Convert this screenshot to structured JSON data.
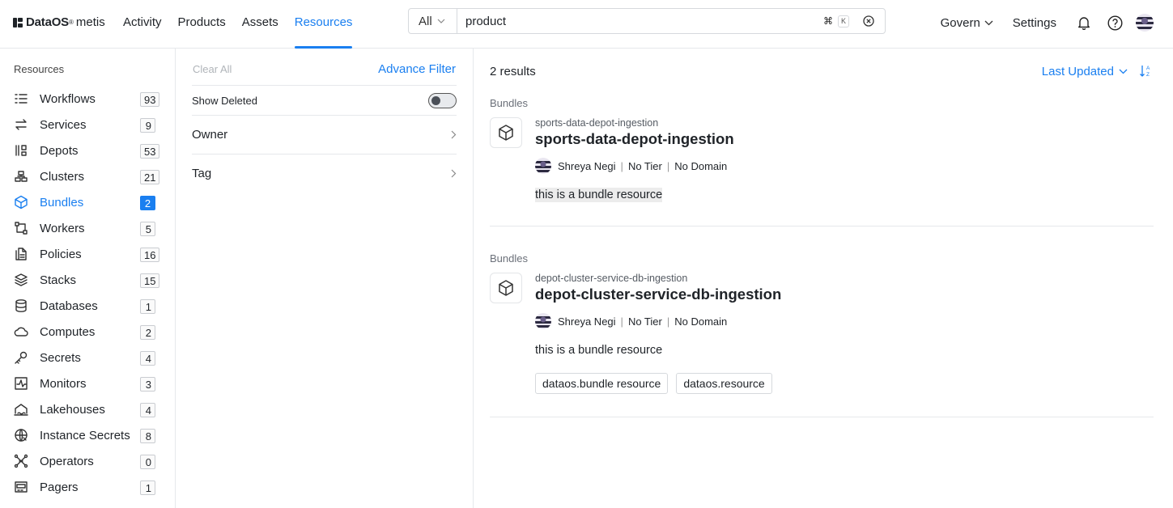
{
  "header": {
    "logo": {
      "brand": "DataOS",
      "sup": "®",
      "product": "metis"
    },
    "nav": [
      {
        "label": "Activity",
        "active": false
      },
      {
        "label": "Products",
        "active": false
      },
      {
        "label": "Assets",
        "active": false
      },
      {
        "label": "Resources",
        "active": true
      }
    ],
    "search": {
      "scope": "All",
      "value": "product",
      "shortcut_cmd": "⌘",
      "shortcut_key": "K"
    },
    "govern_label": "Govern",
    "settings_label": "Settings",
    "icons": [
      "bell-icon",
      "help-icon",
      "avatar"
    ]
  },
  "sidebar": {
    "title": "Resources",
    "items": [
      {
        "label": "Workflows",
        "count": "93",
        "icon": "workflow-icon"
      },
      {
        "label": "Services",
        "count": "9",
        "icon": "services-icon"
      },
      {
        "label": "Depots",
        "count": "53",
        "icon": "depot-icon"
      },
      {
        "label": "Clusters",
        "count": "21",
        "icon": "cluster-icon"
      },
      {
        "label": "Bundles",
        "count": "2",
        "icon": "bundle-icon",
        "active": true
      },
      {
        "label": "Workers",
        "count": "5",
        "icon": "worker-icon"
      },
      {
        "label": "Policies",
        "count": "16",
        "icon": "policy-icon"
      },
      {
        "label": "Stacks",
        "count": "15",
        "icon": "stack-icon"
      },
      {
        "label": "Databases",
        "count": "1",
        "icon": "database-icon"
      },
      {
        "label": "Computes",
        "count": "2",
        "icon": "cloud-icon"
      },
      {
        "label": "Secrets",
        "count": "4",
        "icon": "key-icon"
      },
      {
        "label": "Monitors",
        "count": "3",
        "icon": "monitor-icon"
      },
      {
        "label": "Lakehouses",
        "count": "4",
        "icon": "lakehouse-icon"
      },
      {
        "label": "Instance Secrets",
        "count": "8",
        "icon": "instance-secret-icon"
      },
      {
        "label": "Operators",
        "count": "0",
        "icon": "operator-icon"
      },
      {
        "label": "Pagers",
        "count": "1",
        "icon": "pager-icon"
      }
    ]
  },
  "filters": {
    "clear_all": "Clear All",
    "advance_filter": "Advance Filter",
    "show_deleted": "Show Deleted",
    "owner": "Owner",
    "tag": "Tag"
  },
  "results": {
    "count_label": "2 results",
    "sort_label": "Last Updated",
    "items": [
      {
        "type": "Bundles",
        "subtitle": "sports-data-depot-ingestion",
        "title": "sports-data-depot-ingestion",
        "owner": "Shreya Negi",
        "tier": "No Tier",
        "domain": "No Domain",
        "description": "this is a bundle resource",
        "tags": []
      },
      {
        "type": "Bundles",
        "subtitle": "depot-cluster-service-db-ingestion",
        "title": "depot-cluster-service-db-ingestion",
        "owner": "Shreya Negi",
        "tier": "No Tier",
        "domain": "No Domain",
        "description": "this is a bundle resource",
        "tags": [
          "dataos.bundle resource",
          "dataos.resource"
        ]
      }
    ]
  },
  "colors": {
    "accent": "#1a7ff0",
    "text": "#1f2328",
    "border": "#e6e8eb"
  }
}
